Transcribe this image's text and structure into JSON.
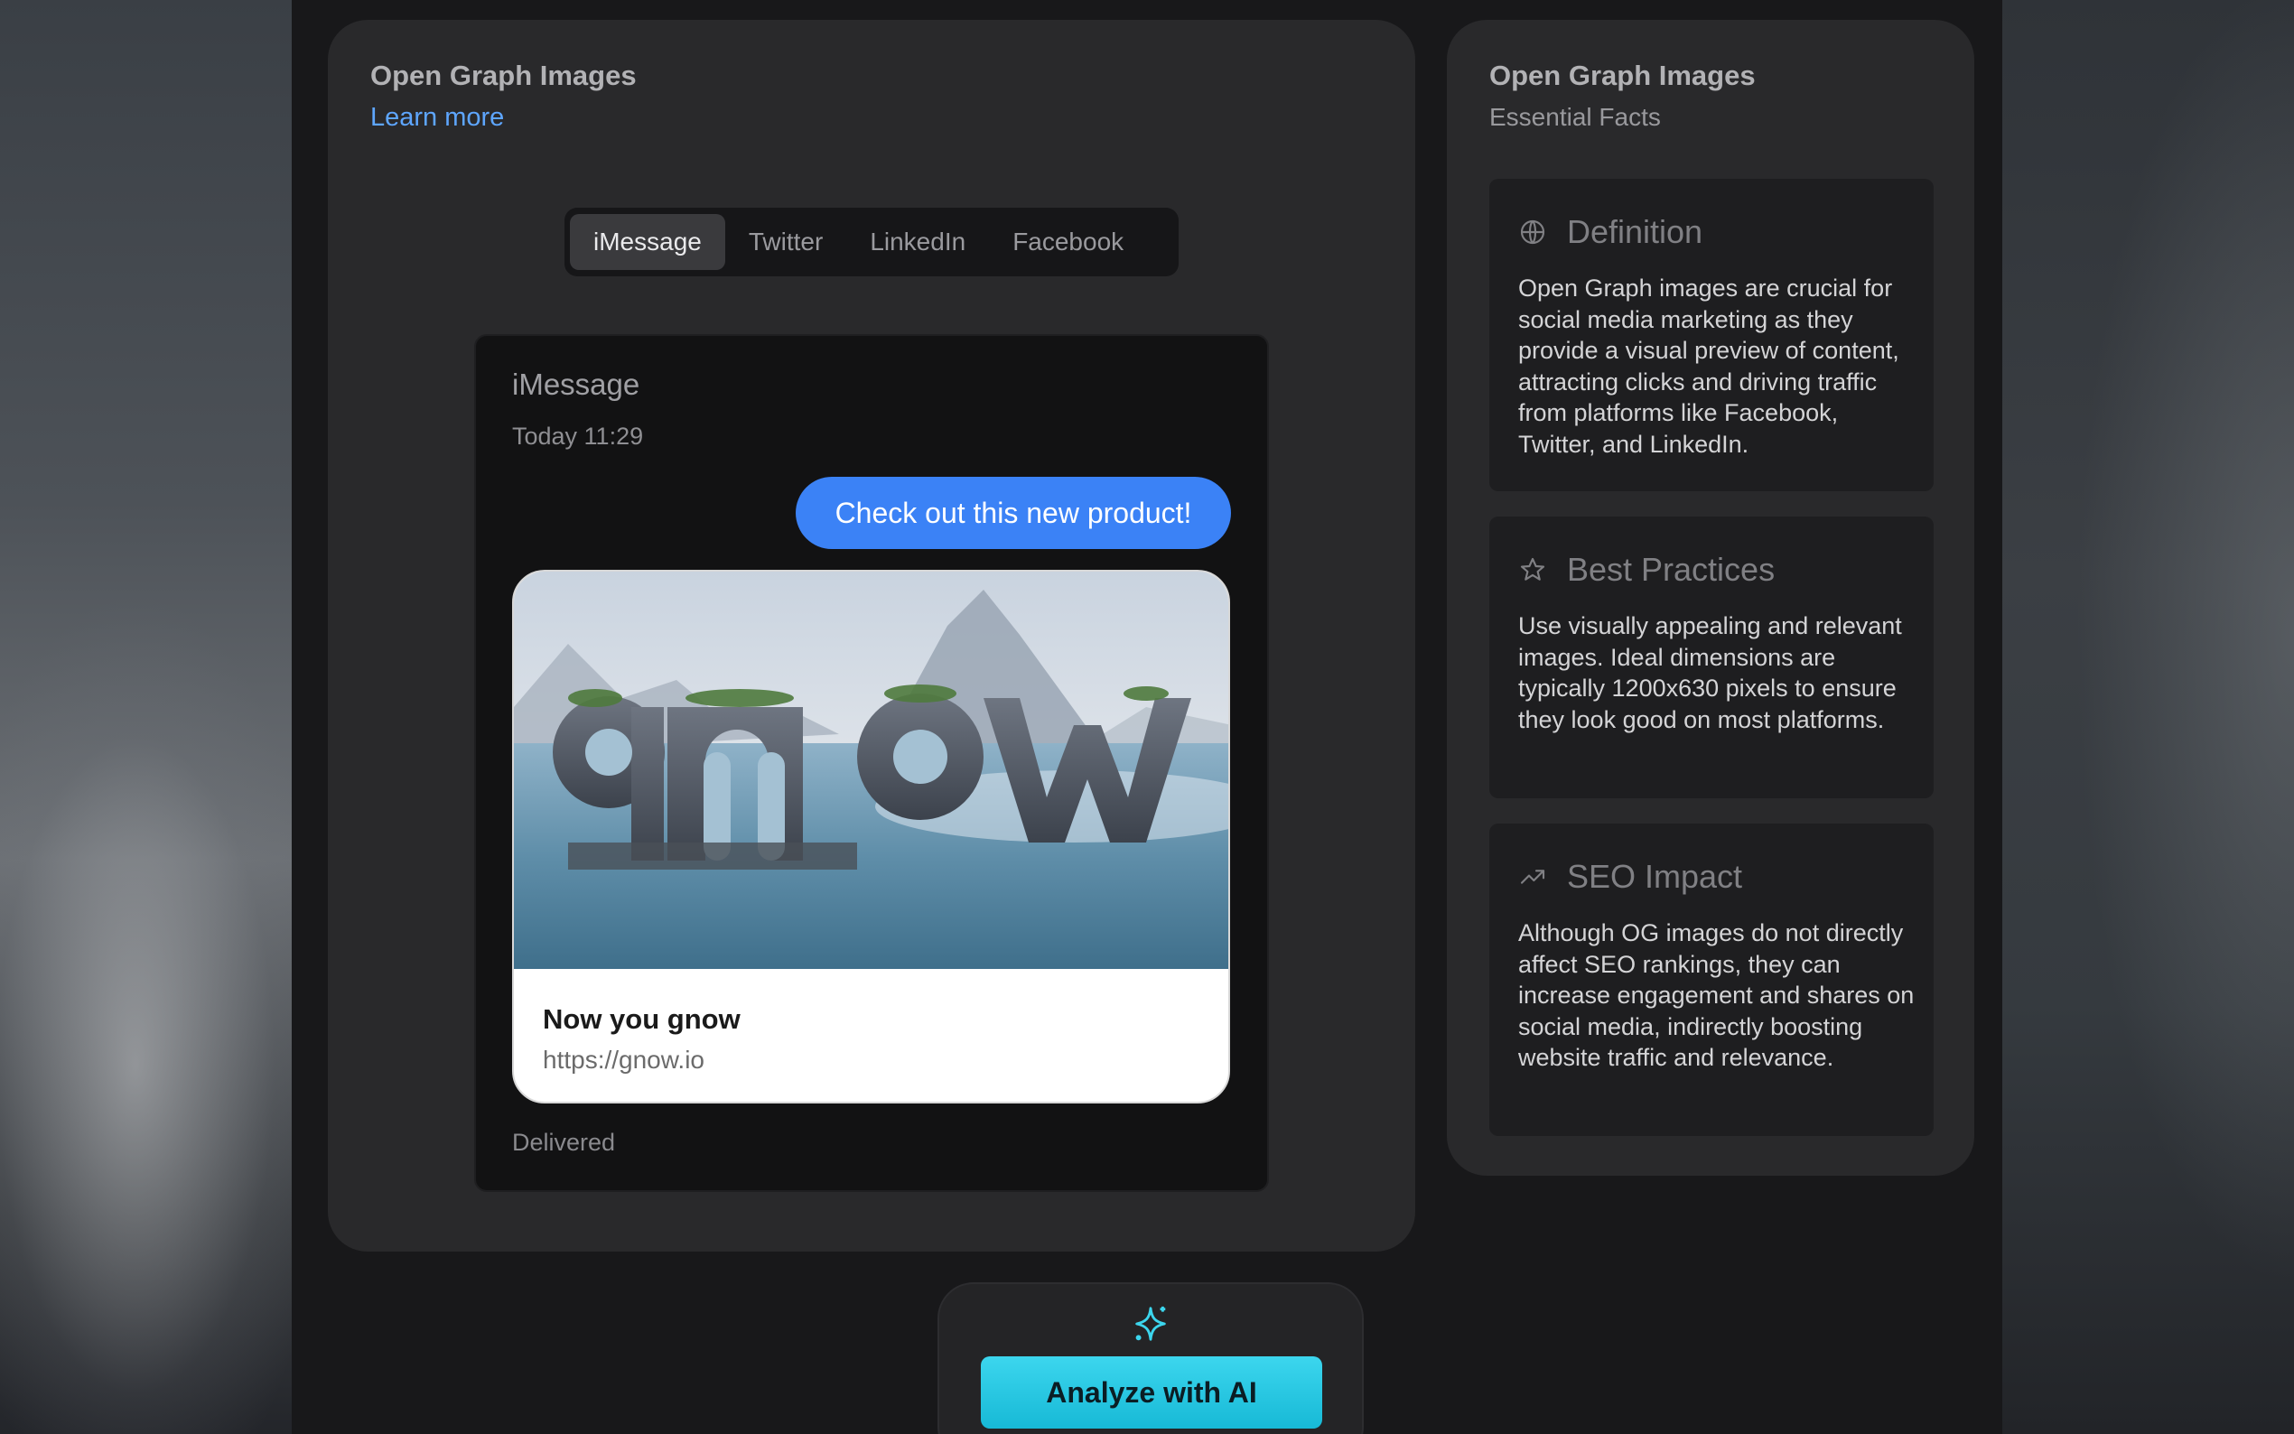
{
  "preview_panel": {
    "title": "Open Graph Images",
    "learn_more": "Learn more",
    "tabs": [
      {
        "label": "iMessage",
        "active": true
      },
      {
        "label": "Twitter",
        "active": false
      },
      {
        "label": "LinkedIn",
        "active": false
      },
      {
        "label": "Facebook",
        "active": false
      }
    ],
    "imessage": {
      "app_name": "iMessage",
      "timestamp": "Today 11:29",
      "message": "Check out this new product!",
      "link_title": "Now you gnow",
      "link_url": "https://gnow.io",
      "status": "Delivered"
    }
  },
  "facts_panel": {
    "title": "Open Graph Images",
    "subtitle": "Essential Facts",
    "items": [
      {
        "icon": "globe-icon",
        "title": "Definition",
        "text": "Open Graph images are crucial for social media marketing as they provide a visual preview of content, attracting clicks and driving traffic from platforms like Facebook, Twitter, and LinkedIn."
      },
      {
        "icon": "star-icon",
        "title": "Best Practices",
        "text": "Use visually appealing and relevant images. Ideal dimensions are typically 1200x630 pixels to ensure they look good on most platforms."
      },
      {
        "icon": "trending-up-icon",
        "title": "SEO Impact",
        "text": "Although OG images do not directly affect SEO rankings, they can increase engagement and shares on social media, indirectly boosting website traffic and relevance."
      }
    ]
  },
  "ai": {
    "icon": "sparkle-icon",
    "button_label": "Analyze with AI"
  },
  "colors": {
    "accent_blue": "#3b82f6",
    "link_blue": "#5ea6ff",
    "ai_cyan": "#22c3e0"
  }
}
